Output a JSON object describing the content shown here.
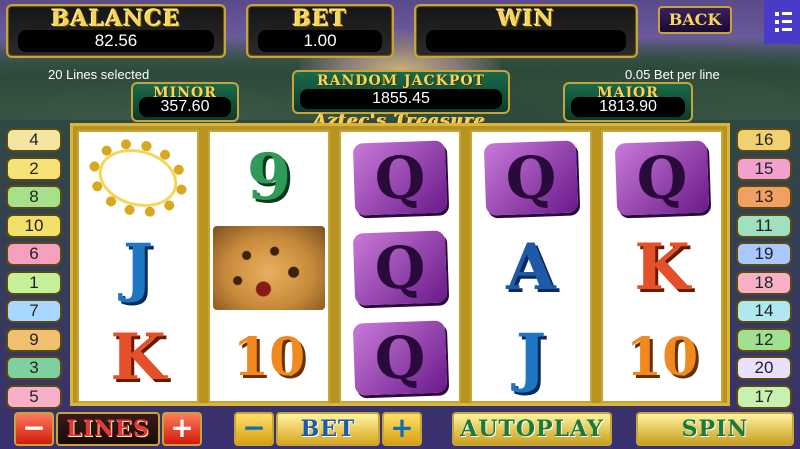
{
  "meters": {
    "balance": {
      "label": "BALANCE",
      "value": "82.56"
    },
    "bet": {
      "label": "BET",
      "value": "1.00"
    },
    "win": {
      "label": "WIN",
      "value": ""
    }
  },
  "back_label": "BACK",
  "lines_selected": "20 Lines selected",
  "bet_per_line": "0.05 Bet per line",
  "jackpots": {
    "minor": {
      "label": "MINOR",
      "value": "357.60"
    },
    "random": {
      "label": "RANDOM JACKPOT",
      "value": "1855.45"
    },
    "major": {
      "label": "MAJOR",
      "value": "1813.90"
    }
  },
  "game_title": "Aztec's Treasure",
  "left_lines": [
    {
      "n": "4",
      "color": "#f3e6a0"
    },
    {
      "n": "2",
      "color": "#f7e27a"
    },
    {
      "n": "8",
      "color": "#a6e08a"
    },
    {
      "n": "10",
      "color": "#f1e06a"
    },
    {
      "n": "6",
      "color": "#f6a0c0"
    },
    {
      "n": "1",
      "color": "#c6ef9a"
    },
    {
      "n": "7",
      "color": "#a8d8ff"
    },
    {
      "n": "9",
      "color": "#f0c070"
    },
    {
      "n": "3",
      "color": "#7ed0a0"
    },
    {
      "n": "5",
      "color": "#f7b0c8"
    }
  ],
  "right_lines": [
    {
      "n": "16",
      "color": "#f0d070"
    },
    {
      "n": "15",
      "color": "#f2a0d0"
    },
    {
      "n": "13",
      "color": "#f0a060"
    },
    {
      "n": "11",
      "color": "#a0e0c0"
    },
    {
      "n": "19",
      "color": "#a8c8ff"
    },
    {
      "n": "18",
      "color": "#f8b0c8"
    },
    {
      "n": "14",
      "color": "#b0e8f0"
    },
    {
      "n": "12",
      "color": "#a0e090"
    },
    {
      "n": "20",
      "color": "#e8e0ff"
    },
    {
      "n": "17",
      "color": "#c8f0b0"
    }
  ],
  "reels": [
    [
      "necklace",
      "J",
      "K"
    ],
    [
      "9",
      "jaguar",
      "10"
    ],
    [
      "Q",
      "Q",
      "Q"
    ],
    [
      "Q",
      "A",
      "J"
    ],
    [
      "Q",
      "K",
      "10"
    ]
  ],
  "controls": {
    "minus": "−",
    "plus": "+",
    "lines_label": "LINES",
    "bet_label": "BET",
    "autoplay_label": "AUTOPLAY",
    "spin_label": "SPIN"
  }
}
